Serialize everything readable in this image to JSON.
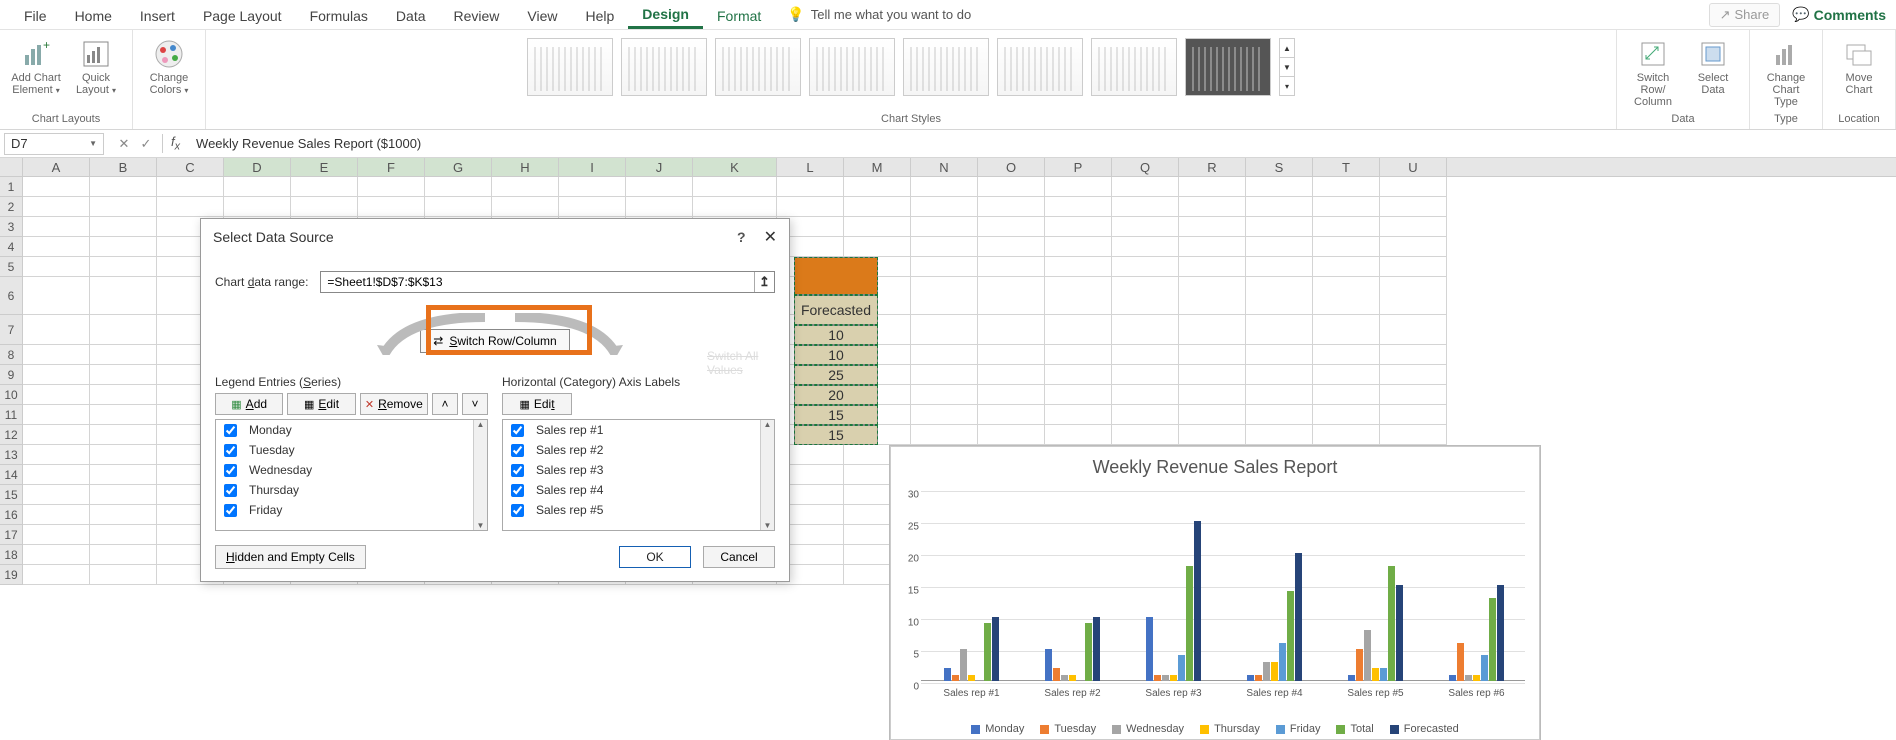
{
  "ribbon": {
    "tabs": [
      "File",
      "Home",
      "Insert",
      "Page Layout",
      "Formulas",
      "Data",
      "Review",
      "View",
      "Help",
      "Design",
      "Format"
    ],
    "active_tab": "Design",
    "tellme_placeholder": "Tell me what you want to do",
    "share": "Share",
    "comments": "Comments",
    "groups": {
      "chart_layouts": {
        "label": "Chart Layouts",
        "add_chart_element": "Add Chart Element",
        "quick_layout": "Quick Layout"
      },
      "change_colors": "Change Colors",
      "chart_styles": {
        "label": "Chart Styles"
      },
      "data": {
        "label": "Data",
        "switch_row_col": "Switch Row/\nColumn",
        "select_data": "Select Data"
      },
      "type": {
        "label": "Type",
        "change_chart_type": "Change Chart Type"
      },
      "location": {
        "label": "Location",
        "move_chart": "Move Chart"
      }
    }
  },
  "namebox": {
    "ref": "D7"
  },
  "formula_bar": {
    "value": "Weekly Revenue Sales Report ($1000)"
  },
  "columns": [
    "A",
    "B",
    "C",
    "D",
    "E",
    "F",
    "G",
    "H",
    "I",
    "J",
    "K",
    "L",
    "M",
    "N",
    "O",
    "P",
    "Q",
    "R",
    "S",
    "T",
    "U"
  ],
  "selected_cols": [
    "D",
    "E",
    "F",
    "G",
    "H",
    "I",
    "J",
    "K"
  ],
  "rows": [
    1,
    2,
    3,
    4,
    5,
    6,
    7,
    8,
    9,
    10,
    11,
    12,
    13,
    14,
    15,
    16,
    17,
    18,
    19
  ],
  "visible_k": {
    "header_cell": "",
    "subheader": "Forecasted",
    "values": [
      "10",
      "10",
      "25",
      "20",
      "15",
      "15"
    ]
  },
  "dialog": {
    "title": "Select Data Source",
    "range_label": "Chart data range:",
    "range_value": "=Sheet1!$D$7:$K$13",
    "switch_btn": "Switch Row/Column",
    "ghost": "Switch All Values",
    "legend_label": "Legend Entries (Series)",
    "axis_label": "Horizontal (Category) Axis Labels",
    "add": "Add",
    "edit": "Edit",
    "remove": "Remove",
    "series": [
      "Monday",
      "Tuesday",
      "Wednesday",
      "Thursday",
      "Friday"
    ],
    "categories": [
      "Sales rep #1",
      "Sales rep #2",
      "Sales rep #3",
      "Sales rep #4",
      "Sales rep #5"
    ],
    "hidden_empty": "Hidden and Empty Cells",
    "ok": "OK",
    "cancel": "Cancel"
  },
  "chart_data": {
    "type": "bar",
    "title": "Weekly Revenue Sales Report",
    "categories": [
      "Sales rep #1",
      "Sales rep #2",
      "Sales rep #3",
      "Sales rep #4",
      "Sales rep #5",
      "Sales rep #6"
    ],
    "series": [
      {
        "name": "Monday",
        "color": "#4472C4",
        "values": [
          2,
          5,
          10,
          1,
          1,
          1
        ]
      },
      {
        "name": "Tuesday",
        "color": "#ED7D31",
        "values": [
          1,
          2,
          1,
          1,
          5,
          6
        ]
      },
      {
        "name": "Wednesday",
        "color": "#A5A5A5",
        "values": [
          5,
          1,
          1,
          3,
          8,
          1
        ]
      },
      {
        "name": "Thursday",
        "color": "#FFC000",
        "values": [
          1,
          1,
          1,
          3,
          2,
          1
        ]
      },
      {
        "name": "Friday",
        "color": "#5B9BD5",
        "values": [
          0,
          0,
          4,
          6,
          2,
          4
        ]
      },
      {
        "name": "Total",
        "color": "#70AD47",
        "values": [
          9,
          9,
          18,
          14,
          18,
          13
        ]
      },
      {
        "name": "Forecasted",
        "color": "#264478",
        "values": [
          10,
          10,
          25,
          20,
          15,
          15
        ]
      }
    ],
    "ylabel": "",
    "xlabel": "",
    "ylim": [
      0,
      30
    ],
    "yticks": [
      0,
      5,
      10,
      15,
      20,
      25,
      30
    ]
  }
}
